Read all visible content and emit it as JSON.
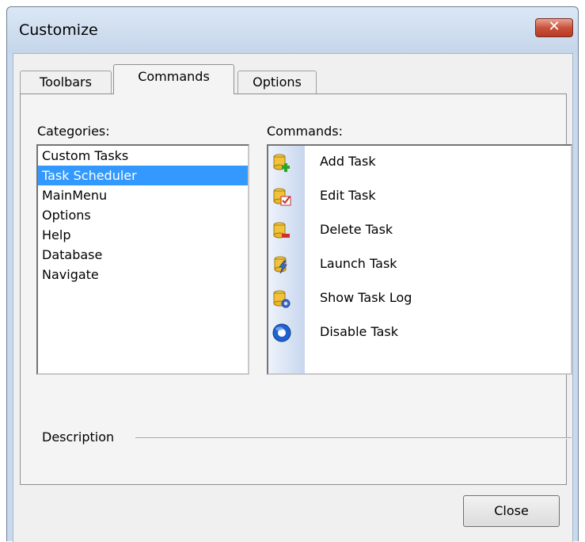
{
  "window": {
    "title": "Customize"
  },
  "tabs": [
    {
      "label": "Toolbars"
    },
    {
      "label": "Commands"
    },
    {
      "label": "Options"
    }
  ],
  "categories": {
    "label": "Categories:",
    "items": [
      "Custom Tasks",
      "Task Scheduler",
      "MainMenu",
      "Options",
      "Help",
      "Database",
      "Navigate"
    ],
    "selected": "Task Scheduler"
  },
  "commands": {
    "label": "Commands:",
    "items": [
      {
        "label": "Add Task",
        "icon": "add-task-icon"
      },
      {
        "label": "Edit Task",
        "icon": "edit-task-icon"
      },
      {
        "label": "Delete Task",
        "icon": "delete-task-icon"
      },
      {
        "label": "Launch Task",
        "icon": "launch-task-icon"
      },
      {
        "label": "Show Task Log",
        "icon": "show-task-log-icon"
      },
      {
        "label": "Disable Task",
        "icon": "disable-task-icon"
      }
    ]
  },
  "description": {
    "label": "Description"
  },
  "buttons": {
    "close": "Close"
  },
  "colors": {
    "selection": "#3399ff",
    "close_x": "#c9523b"
  }
}
